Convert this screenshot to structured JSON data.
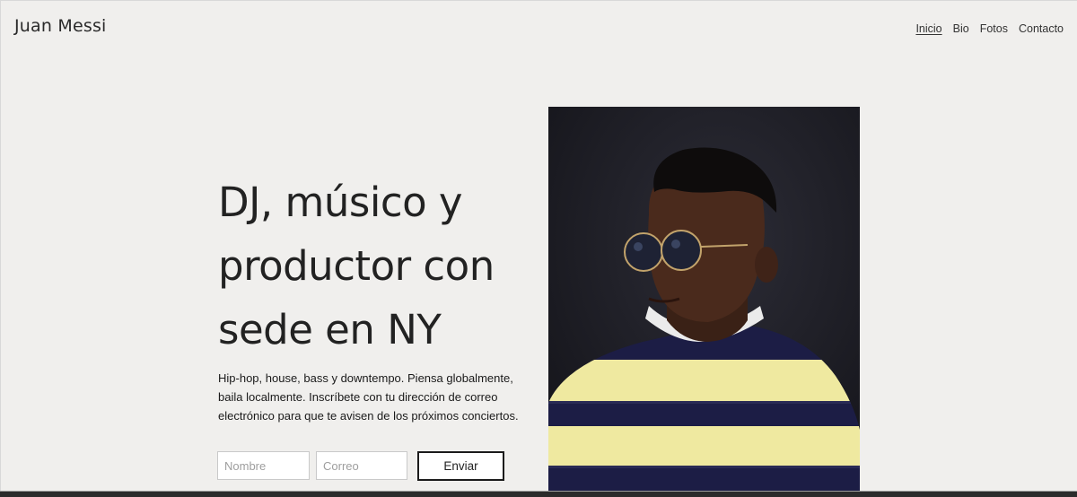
{
  "site": {
    "title": "Juan Messi"
  },
  "nav": {
    "items": [
      {
        "label": "Inicio",
        "active": true
      },
      {
        "label": "Bio",
        "active": false
      },
      {
        "label": "Fotos",
        "active": false
      },
      {
        "label": "Contacto",
        "active": false
      }
    ]
  },
  "hero": {
    "headline": "DJ, músico  y\nproductor con\nsede en NY",
    "description": "Hip-hop, house, bass y downtempo. Piensa globalmente, baila localmente. Inscríbete con tu dirección de correo electrónico para que te avisen de los próximos conciertos.",
    "image_alt": "portrait"
  },
  "form": {
    "name_placeholder": "Nombre",
    "email_placeholder": "Correo",
    "submit_label": "Enviar"
  },
  "colors": {
    "background": "#f0efed",
    "text": "#222222",
    "button_border": "#1b1b1b",
    "photo_backdrop": "#1f1f27",
    "sweater_yellow": "#efe9a0",
    "sweater_navy": "#1c1d45"
  }
}
